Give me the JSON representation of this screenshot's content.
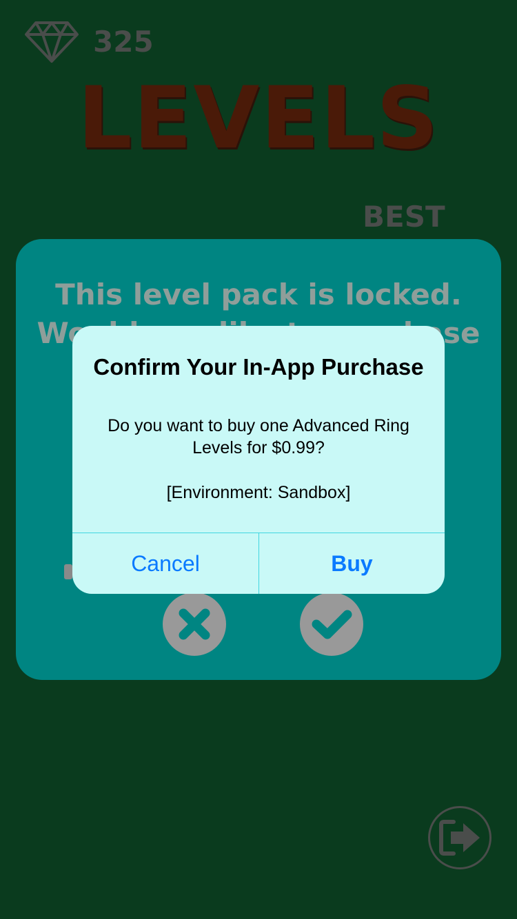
{
  "header": {
    "gem_icon": "diamond-icon",
    "gem_count": "325",
    "title": "LEVELS",
    "best_label": "BEST"
  },
  "locked_panel": {
    "line1": "This level pack is locked.",
    "line2": "Would you like to purchase",
    "cancel_icon": "x-icon",
    "confirm_icon": "checkmark-icon"
  },
  "exit_icon": "exit-arrow-icon",
  "alert": {
    "title": "Confirm Your In-App Purchase",
    "message": "Do you want to buy one Advanced Ring Levels for $0.99?",
    "environment": "[Environment: Sandbox]",
    "cancel_label": "Cancel",
    "buy_label": "Buy"
  },
  "colors": {
    "background": "#0a3b1e",
    "panel": "#008582",
    "alert_bg": "#c9f9f7",
    "ios_blue": "#0a7aff",
    "title_brown": "#4a1a08"
  }
}
